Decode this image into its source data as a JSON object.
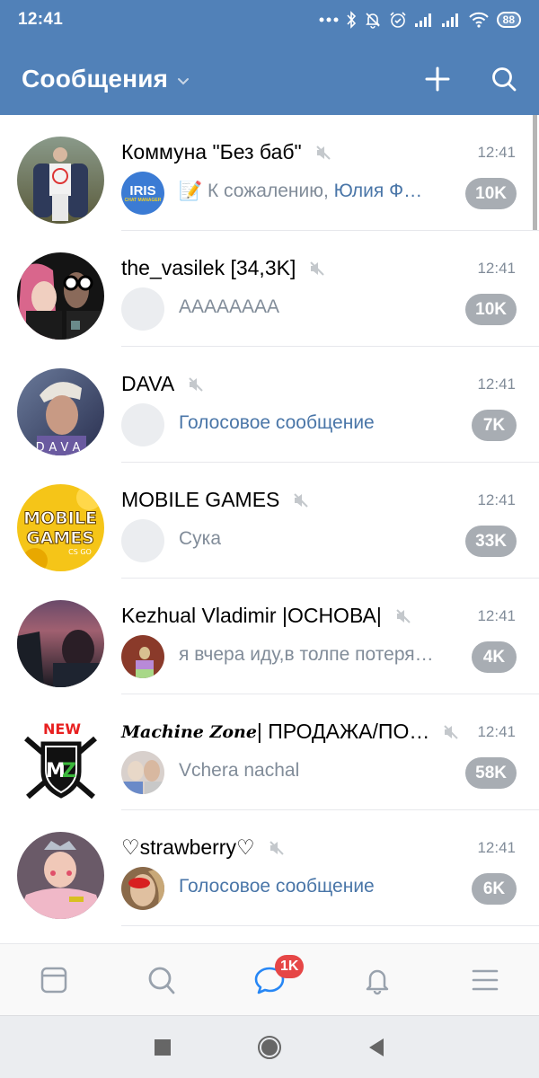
{
  "status_bar": {
    "time": "12:41",
    "icons": [
      "more-dots-icon",
      "bluetooth-icon",
      "bell-off-icon",
      "alarm-icon",
      "signal-icon",
      "signal-icon",
      "wifi-icon"
    ],
    "battery": "88"
  },
  "header": {
    "title": "Сообщения",
    "title_dropdown_icon": "chevron-down-icon",
    "actions": [
      "plus-icon",
      "search-icon"
    ]
  },
  "conversations": [
    {
      "name": "Коммуна \"Без баб\"",
      "muted": true,
      "time": "12:41",
      "sender_avatar": "IRIS chat manager",
      "preview_prefix": "📝 К сожалению, ",
      "preview_highlight": "Юлия Ф…",
      "unread": "10K",
      "avatar_colors": [
        "#4a5a3a",
        "#8a9a7a"
      ]
    },
    {
      "name": "the_vasilek [34,3K]",
      "muted": true,
      "time": "12:41",
      "preview": "АААААААА",
      "unread": "10K",
      "avatar_colors": [
        "#111111",
        "#d36a8a"
      ]
    },
    {
      "name": "DAVA",
      "muted": true,
      "time": "12:41",
      "preview": "Голосовое сообщение",
      "preview_is_link": true,
      "unread": "7K",
      "avatar_colors": [
        "#3a4a6a",
        "#c8b8a8"
      ]
    },
    {
      "name": "MOBILE GAMES",
      "muted": true,
      "time": "12:41",
      "preview": "Сука",
      "unread": "33K",
      "avatar_colors": [
        "#f5c518",
        "#e8a800"
      ]
    },
    {
      "name": "Kezhual Vladimir |ОСНОВА|",
      "muted": true,
      "time": "12:41",
      "preview": "я вчера иду,в толпе потеря…",
      "unread": "4K",
      "avatar_colors": [
        "#2a2a3a",
        "#8a4a6a"
      ],
      "has_sender_photo": true
    },
    {
      "name_styled": "Machine Zone",
      "name": " | ПРОДАЖА/ПО…",
      "muted": true,
      "time": "12:41",
      "preview": "Vchera nachal",
      "unread": "58K",
      "avatar_label": "NEW",
      "avatar_logo": "MZ",
      "has_sender_photo": true
    },
    {
      "name": "♡strawberry♡",
      "muted": true,
      "time": "12:41",
      "preview": "Голосовое сообщение",
      "preview_is_link": true,
      "unread": "6K",
      "avatar_colors": [
        "#c89aa8",
        "#8a6a7a"
      ],
      "has_sender_photo": true
    }
  ],
  "tabbar": {
    "items": [
      "news-icon",
      "search-icon",
      "messages-icon",
      "notifications-icon",
      "menu-icon"
    ],
    "active": "messages-icon",
    "messages_badge": "1K"
  },
  "colors": {
    "header_bg": "#5181b8",
    "link": "#4a76a8",
    "badge_muted": "#a8adb3",
    "badge_alert": "#e64646",
    "tab_active": "#2787f5"
  }
}
